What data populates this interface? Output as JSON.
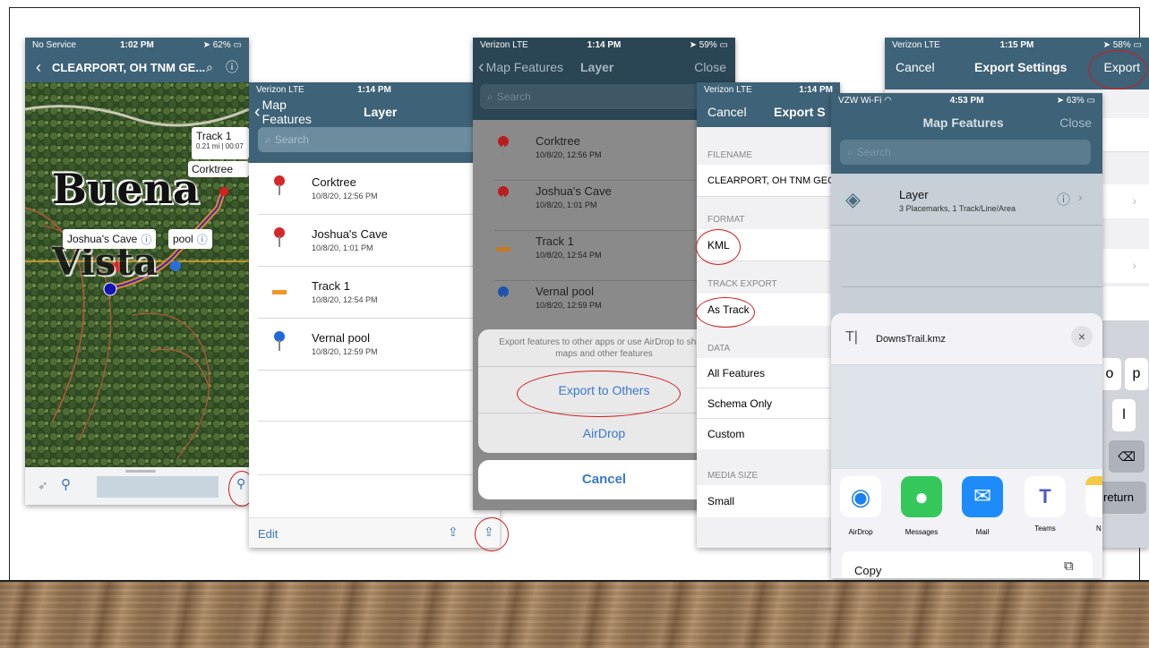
{
  "screen1": {
    "status": {
      "carrier": "No Service",
      "time": "1:02 PM",
      "battery": "62%"
    },
    "title": "CLEARPORT, OH TNM GE...",
    "map_label_big1": "Buena",
    "map_label_big2": "Vista",
    "callout_track": {
      "title": "Track 1",
      "sub": "0.21 mi | 00:07"
    },
    "callout_corktree": "Corktree",
    "callout_joshua": "Joshua's Cave",
    "callout_pool": "pool",
    "colors": {
      "nav": "#3e6277",
      "route": "#e8852b",
      "track": "#2b2fb5"
    }
  },
  "screen2": {
    "status": {
      "carrier": "Verizon  LTE",
      "time": "1:14 PM"
    },
    "nav": {
      "back": "Map Features",
      "title": "Layer"
    },
    "search_placeholder": "Search",
    "items": [
      {
        "title": "Corktree",
        "sub": "10/8/20, 12:56 PM",
        "icon": "red-pin-icon"
      },
      {
        "title": "Joshua's Cave",
        "sub": "10/8/20, 1:01 PM",
        "icon": "red-pin-icon"
      },
      {
        "title": "Track 1",
        "sub": "10/8/20, 12:54 PM",
        "icon": "orange-track-icon"
      },
      {
        "title": "Vernal pool",
        "sub": "10/8/20, 12:59 PM",
        "icon": "blue-pin-icon"
      }
    ],
    "edit": "Edit"
  },
  "screen3": {
    "status": {
      "carrier": "Verizon  LTE",
      "time": "1:14 PM",
      "battery": "59%"
    },
    "nav": {
      "back": "Map Features",
      "title": "Layer",
      "close": "Close"
    },
    "search_placeholder": "Search",
    "items": [
      {
        "title": "Corktree",
        "sub": "10/8/20, 12:56 PM"
      },
      {
        "title": "Joshua's Cave",
        "sub": "10/8/20, 1:01 PM"
      },
      {
        "title": "Track 1",
        "sub": "10/8/20, 12:54 PM"
      },
      {
        "title": "Vernal pool",
        "sub": "10/8/20, 12:59 PM"
      }
    ],
    "sheet_message": "Export features to other apps or use AirDrop to share maps and other features",
    "export_others": "Export to Others",
    "airdrop": "AirDrop",
    "cancel": "Cancel"
  },
  "screen4": {
    "status": {
      "carrier": "Verizon  LTE",
      "time": "1:14 PM"
    },
    "nav": {
      "cancel": "Cancel",
      "title": "Export S"
    },
    "filename_header": "FILENAME",
    "filename": "CLEARPORT, OH TNM GEO",
    "format_header": "FORMAT",
    "format": "KML",
    "track_header": "TRACK EXPORT",
    "track": "As Track",
    "data_header": "DATA",
    "data_options": [
      "All Features",
      "Schema Only",
      "Custom"
    ],
    "media_header": "MEDIA SIZE",
    "media": "Small"
  },
  "screen5": {
    "status": {
      "carrier": "Verizon  LTE",
      "time": "1:15 PM",
      "battery": "58%"
    },
    "nav": {
      "cancel": "Cancel",
      "title": "Export Settings",
      "export": "Export"
    },
    "keys": [
      "o",
      "p",
      "l",
      "return"
    ]
  },
  "screen6": {
    "status": {
      "carrier": "VZW Wi-Fi",
      "time": "4:53 PM",
      "battery": "63%"
    },
    "nav": {
      "title": "Map Features",
      "close": "Close"
    },
    "search_placeholder": "Search",
    "layer": {
      "title": "Layer",
      "sub": "3 Placemarks, 1 Track/Line/Area"
    },
    "share_file": "DownsTrail.kmz",
    "apps": [
      "AirDrop",
      "Messages",
      "Mail",
      "Teams",
      "N"
    ],
    "copy": "Copy"
  }
}
